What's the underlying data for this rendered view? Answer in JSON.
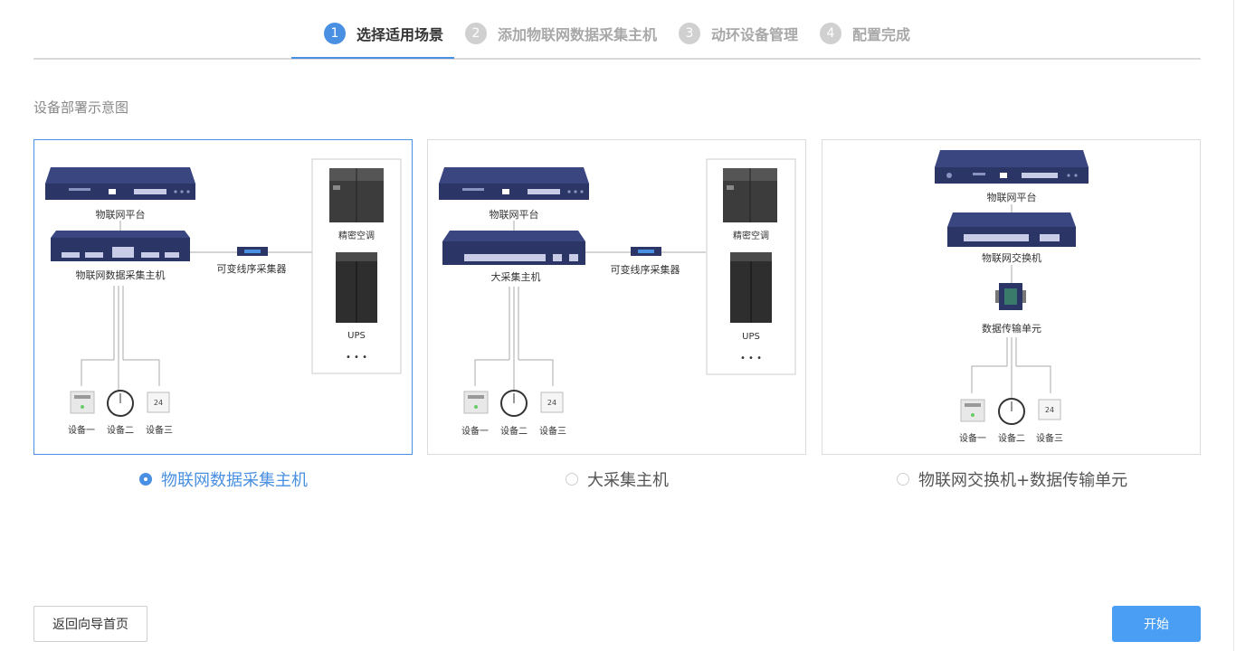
{
  "steps": [
    {
      "num": "1",
      "label": "选择适用场景"
    },
    {
      "num": "2",
      "label": "添加物联网数据采集主机"
    },
    {
      "num": "3",
      "label": "动环设备管理"
    },
    {
      "num": "4",
      "label": "配置完成"
    }
  ],
  "section_title": "设备部署示意图",
  "cards": [
    {
      "platform": "物联网平台",
      "host": "物联网数据采集主机",
      "collector": "可变线序采集器",
      "ac": "精密空调",
      "ups": "UPS",
      "more": "• • •",
      "dev1": "设备一",
      "dev2": "设备二",
      "dev3": "设备三",
      "option": "物联网数据采集主机"
    },
    {
      "platform": "物联网平台",
      "host": "大采集主机",
      "collector": "可变线序采集器",
      "ac": "精密空调",
      "ups": "UPS",
      "more": "• • •",
      "dev1": "设备一",
      "dev2": "设备二",
      "dev3": "设备三",
      "option": "大采集主机"
    },
    {
      "platform": "物联网平台",
      "switch": "物联网交换机",
      "dtu": "数据传输单元",
      "dev1": "设备一",
      "dev2": "设备二",
      "dev3": "设备三",
      "option": "物联网交换机+数据传输单元"
    }
  ],
  "selected_option": 0,
  "buttons": {
    "back": "返回向导首页",
    "start": "开始"
  },
  "colors": {
    "accent": "#4a90e2",
    "device_navy": "#2b3566",
    "button_blue": "#4a9ff5"
  }
}
